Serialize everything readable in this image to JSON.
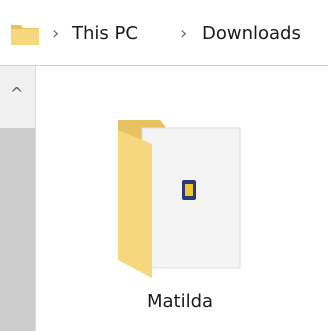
{
  "breadcrumb": {
    "items": [
      {
        "label": "This PC"
      },
      {
        "label": "Downloads"
      }
    ],
    "separator": "›"
  },
  "scrollbar": {
    "up_arrow_glyph": "^"
  },
  "folder": {
    "name": "Matilda",
    "icon": "folder-with-file-icon"
  },
  "colors": {
    "folder_front": "#f6d77e",
    "folder_back": "#e8c262",
    "page_bg": "#ffffff",
    "pane_bg": "#f0f0f0",
    "scroll_thumb": "#cdcdcd"
  }
}
